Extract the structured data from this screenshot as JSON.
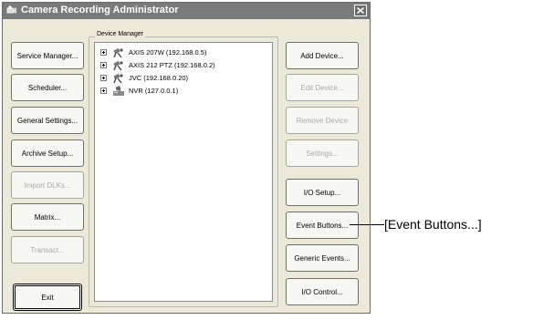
{
  "window": {
    "title": "Camera Recording Administrator",
    "icon": "camera-app-icon"
  },
  "left_buttons": [
    {
      "label": "Service Manager...",
      "enabled": true
    },
    {
      "label": "Scheduler...",
      "enabled": true
    },
    {
      "label": "General Settings...",
      "enabled": true
    },
    {
      "label": "Archive Setup...",
      "enabled": true
    },
    {
      "label": "Import DLKs...",
      "enabled": false
    },
    {
      "label": "Matrix...",
      "enabled": true
    },
    {
      "label": "Transact...",
      "enabled": false
    },
    {
      "label": "Exit",
      "enabled": true
    }
  ],
  "device_manager": {
    "label": "Device Manager",
    "items": [
      {
        "label": "AXIS 207W (192.168.0.5)",
        "icon": "camera-icon"
      },
      {
        "label": "AXIS 212 PTZ (192.168.0.2)",
        "icon": "camera-icon"
      },
      {
        "label": "JVC  (192.168.0.20)",
        "icon": "camera-icon"
      },
      {
        "label": "NVR (127.0.0.1)",
        "icon": "nvr-icon"
      }
    ]
  },
  "right_buttons": [
    {
      "label": "Add Device...",
      "enabled": true
    },
    {
      "label": "Edit Device...",
      "enabled": false
    },
    {
      "label": "Remove Device",
      "enabled": false
    },
    {
      "label": "Settings...",
      "enabled": false
    },
    {
      "label": "I/O Setup...",
      "enabled": true
    },
    {
      "label": "Event Buttons...",
      "enabled": true
    },
    {
      "label": "Generic Events...",
      "enabled": true
    },
    {
      "label": "I/O Control...",
      "enabled": true
    }
  ],
  "callout": {
    "text": "[Event Buttons...]"
  }
}
